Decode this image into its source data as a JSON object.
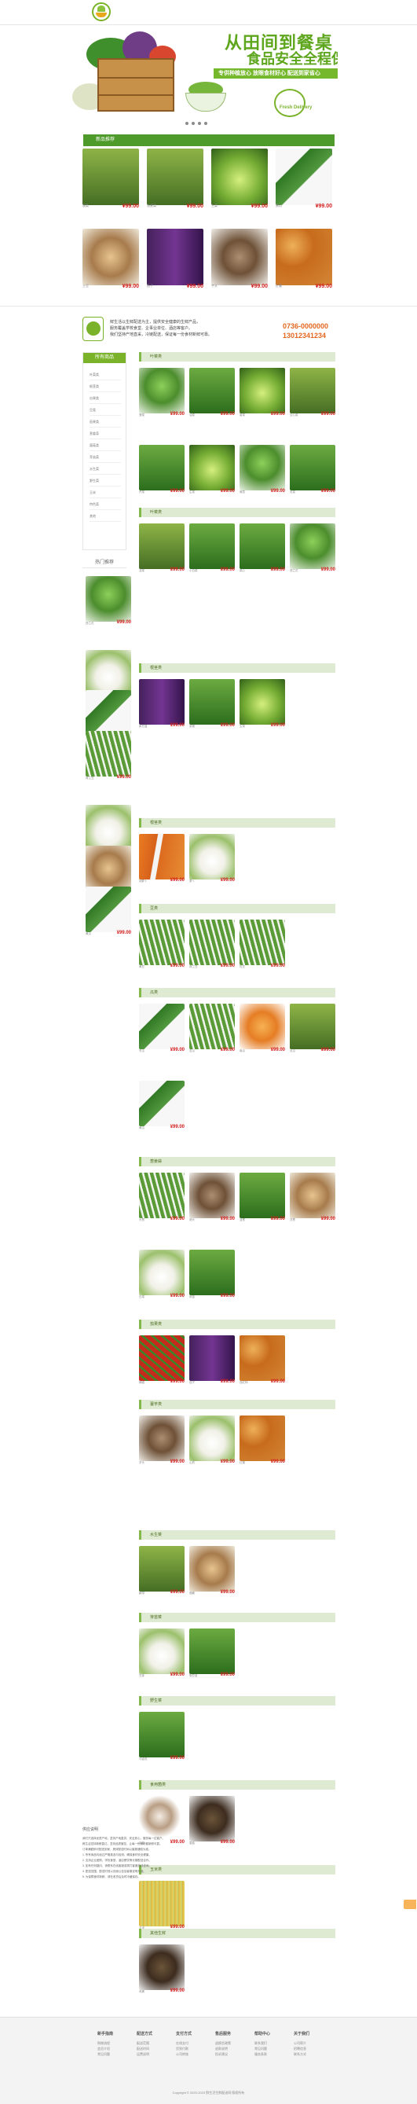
{
  "banner": {
    "title": "从田间到餐桌",
    "subtitle": "食品安全全程保障",
    "strip": "专供种植放心 放眼食材好心 配送到家省心",
    "brand": "Fresh Delivery"
  },
  "section_title": "新品推荐",
  "top_products": [
    {
      "name": "菠菜",
      "price": "¥99.00"
    },
    {
      "name": "油麦菜",
      "price": "¥99.00"
    },
    {
      "name": "生菜",
      "price": "¥99.00"
    },
    {
      "name": "黄瓜",
      "price": "¥99.00"
    },
    {
      "name": "土豆",
      "price": "¥99.00"
    },
    {
      "name": "茄子",
      "price": "¥99.00"
    },
    {
      "name": "芋头",
      "price": "¥99.00"
    },
    {
      "name": "红薯",
      "price": "¥99.00"
    }
  ],
  "info": {
    "text1": "鲜生活以生鲜配送为主，提供安全健康的生鲜产品，",
    "text2": "服务覆盖学校食堂、企事业单位、酒店等客户。",
    "text3": "我们坚持产地直采，冷链配送，保证每一份食材新鲜可靠。",
    "phone1": "0736-0000000",
    "phone2": "13012341234"
  },
  "nav": {
    "title": "所有商品",
    "items": [
      "叶菜类",
      "根茎类",
      "瓜果类",
      "豆类",
      "茄果类",
      "葱姜蒜",
      "菌菇类",
      "芽苗菜",
      "水生菜",
      "野生菜",
      "玉米",
      "特色菜",
      "其他"
    ]
  },
  "hot": {
    "title": "热门推荐",
    "items": [
      {
        "name": "西兰花",
        "price": "¥99.00"
      },
      {
        "name": "萝卜",
        "price": "¥99.00"
      },
      {
        "name": "冬瓜",
        "price": "¥99.00"
      },
      {
        "name": "荷兰豆",
        "price": "¥99.00"
      },
      {
        "name": "白菜",
        "price": "¥99.00"
      },
      {
        "name": "土豆",
        "price": "¥99.00"
      },
      {
        "name": "黄瓜",
        "price": "¥99.00"
      }
    ]
  },
  "categories": [
    {
      "title": "叶菜类",
      "items": [
        {
          "name": "菠菜",
          "price": "¥99.00"
        },
        {
          "name": "油菜",
          "price": "¥99.00"
        },
        {
          "name": "香菜",
          "price": "¥99.00"
        },
        {
          "name": "空心菜",
          "price": "¥99.00"
        },
        {
          "name": "芹菜",
          "price": "¥99.00"
        },
        {
          "name": "生菜",
          "price": "¥99.00"
        },
        {
          "name": "茼蒿",
          "price": "¥99.00"
        },
        {
          "name": "苋菜",
          "price": "¥99.00"
        }
      ]
    },
    {
      "title": "叶菜类",
      "items": [
        {
          "name": "韭菜",
          "price": "¥99.00"
        },
        {
          "name": "小白菜",
          "price": "¥99.00"
        },
        {
          "name": "菜心",
          "price": "¥99.00"
        },
        {
          "name": "西兰花",
          "price": "¥99.00"
        }
      ]
    },
    {
      "title": "根茎类",
      "items": [
        {
          "name": "紫甘蓝",
          "price": "¥99.00"
        },
        {
          "name": "菜薹",
          "price": "¥99.00"
        },
        {
          "name": "生菜",
          "price": "¥99.00"
        }
      ]
    },
    {
      "title": "根茎类",
      "items": [
        {
          "name": "胡萝卜",
          "price": "¥99.00"
        },
        {
          "name": "萝卜",
          "price": "¥99.00"
        }
      ]
    },
    {
      "title": "豆类",
      "items": [
        {
          "name": "黄豆",
          "price": "¥99.00"
        },
        {
          "name": "荷兰豆",
          "price": "¥99.00"
        },
        {
          "name": "豇豆",
          "price": "¥99.00"
        }
      ]
    },
    {
      "title": "瓜类",
      "items": [
        {
          "name": "冬瓜",
          "price": "¥99.00"
        },
        {
          "name": "苦瓜",
          "price": "¥99.00"
        },
        {
          "name": "南瓜",
          "price": "¥99.00"
        },
        {
          "name": "丝瓜",
          "price": "¥99.00"
        },
        {
          "name": "黄瓜",
          "price": "¥99.00"
        }
      ]
    },
    {
      "title": "葱姜蒜",
      "items": [
        {
          "name": "大葱",
          "price": "¥99.00"
        },
        {
          "name": "蒜头",
          "price": "¥99.00"
        },
        {
          "name": "韭葱",
          "price": "¥99.00"
        },
        {
          "name": "洋葱",
          "price": "¥99.00"
        },
        {
          "name": "白菜",
          "price": "¥99.00"
        },
        {
          "name": "蒜苗",
          "price": "¥99.00"
        }
      ]
    },
    {
      "title": "茄果类",
      "items": [
        {
          "name": "辣椒",
          "price": "¥99.00"
        },
        {
          "name": "茄子",
          "price": "¥99.00"
        },
        {
          "name": "西红柿",
          "price": "¥99.00"
        }
      ]
    },
    {
      "title": "薯芋类",
      "items": [
        {
          "name": "芋头",
          "price": "¥99.00"
        },
        {
          "name": "山药",
          "price": "¥99.00"
        },
        {
          "name": "红薯",
          "price": "¥99.00"
        }
      ]
    },
    {
      "title": "水生菜",
      "items": [
        {
          "name": "藕带",
          "price": "¥99.00"
        },
        {
          "name": "莲藕",
          "price": "¥99.00"
        }
      ]
    },
    {
      "title": "芽苗菜",
      "items": [
        {
          "name": "豆芽",
          "price": "¥99.00"
        },
        {
          "name": "豌豆苗",
          "price": "¥99.00"
        }
      ]
    },
    {
      "title": "野生菜",
      "items": [
        {
          "name": "马齿苋",
          "price": "¥99.00"
        }
      ]
    },
    {
      "title": "食用菌类",
      "items": [
        {
          "name": "平菇",
          "price": "¥99.00"
        },
        {
          "name": "香菇",
          "price": "¥99.00"
        }
      ]
    },
    {
      "title": "玉米类",
      "items": [
        {
          "name": "玉米",
          "price": "¥99.00"
        }
      ]
    },
    {
      "title": "其他生鲜",
      "items": [
        {
          "name": "鸡蛋",
          "price": "¥99.00"
        }
      ]
    }
  ],
  "about": {
    "title": "供应说明",
    "lines": [
      "我们只选择优质产地，坚持产地直供，安全放心，服务每一位客户。",
      "鲜生活坚持新鲜直达，坚持品质管控，让每一份食材都新鲜可靠。",
      "订单满额即可配送到家，具体配送时间以客服通知为准。",
      "1. 所有商品均经过严格挑选与检测，确保食材安全健康。",
      "2. 支持企业团购、学校食堂、酒店餐饮等长期配送合作。",
      "3. 如有任何疑问，请联系在线客服或拨打客服热线咨询。",
      "4. 配送范围、配送时效以页面公告及客服说明为准。",
      "5. 为保障食材新鲜，请在收货后及时冷藏保存。"
    ]
  },
  "footer": {
    "cols": [
      {
        "title": "新手指南",
        "items": [
          "购物流程",
          "会员介绍",
          "常见问题"
        ]
      },
      {
        "title": "配送方式",
        "items": [
          "配送范围",
          "配送时间",
          "运费说明"
        ]
      },
      {
        "title": "支付方式",
        "items": [
          "在线支付",
          "货到付款",
          "公司转账"
        ]
      },
      {
        "title": "售后服务",
        "items": [
          "退换货政策",
          "退款说明",
          "投诉建议"
        ]
      },
      {
        "title": "帮助中心",
        "items": [
          "联系我们",
          "常见问题",
          "服务条款"
        ]
      },
      {
        "title": "关于我们",
        "items": [
          "公司简介",
          "招聘信息",
          "联系方式"
        ]
      }
    ],
    "copyright": "Copyright © 2020-2023 鲜生活生鲜配送网 版权所有"
  }
}
